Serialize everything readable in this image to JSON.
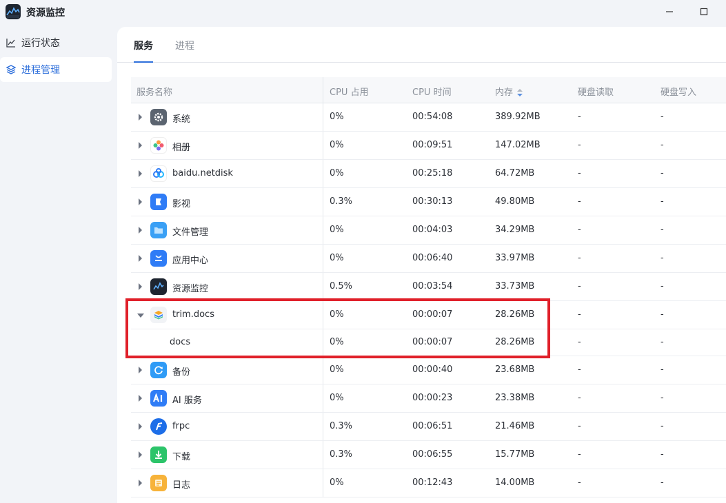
{
  "app": {
    "title": "资源监控",
    "icon": "resource-monitor-icon"
  },
  "window_controls": {
    "minimize": "minimize-icon",
    "maximize": "maximize-icon"
  },
  "sidebar": {
    "items": [
      {
        "label": "运行状态",
        "icon": "line-chart-icon",
        "active": false
      },
      {
        "label": "进程管理",
        "icon": "layers-icon",
        "active": true
      }
    ]
  },
  "tabs": [
    {
      "label": "服务",
      "active": true
    },
    {
      "label": "进程",
      "active": false
    }
  ],
  "table": {
    "headers": {
      "name": "服务名称",
      "cpu": "CPU 占用",
      "time": "CPU 时间",
      "mem": "内存",
      "read": "硬盘读取",
      "write": "硬盘写入"
    },
    "sort_icon": "sort-icon",
    "rows": [
      {
        "name": "系统",
        "cpu": "0%",
        "time": "00:54:08",
        "mem": "389.92MB",
        "read": "-",
        "write": "-",
        "icon": "gear-icon"
      },
      {
        "name": "相册",
        "cpu": "0%",
        "time": "00:09:51",
        "mem": "147.02MB",
        "read": "-",
        "write": "-",
        "icon": "photos-icon"
      },
      {
        "name": "baidu.netdisk",
        "cpu": "0%",
        "time": "00:25:18",
        "mem": "64.72MB",
        "read": "-",
        "write": "-",
        "icon": "baidu-netdisk-icon"
      },
      {
        "name": "影视",
        "cpu": "0.3%",
        "time": "00:30:13",
        "mem": "49.80MB",
        "read": "-",
        "write": "-",
        "icon": "video-icon"
      },
      {
        "name": "文件管理",
        "cpu": "0%",
        "time": "00:04:03",
        "mem": "34.29MB",
        "read": "-",
        "write": "-",
        "icon": "folder-icon"
      },
      {
        "name": "应用中心",
        "cpu": "0%",
        "time": "00:06:40",
        "mem": "33.97MB",
        "read": "-",
        "write": "-",
        "icon": "app-store-icon"
      },
      {
        "name": "资源监控",
        "cpu": "0.5%",
        "time": "00:03:54",
        "mem": "33.73MB",
        "read": "-",
        "write": "-",
        "icon": "resource-monitor-icon"
      },
      {
        "name": "trim.docs",
        "cpu": "0%",
        "time": "00:00:07",
        "mem": "28.26MB",
        "read": "-",
        "write": "-",
        "icon": "docs-icon",
        "expanded": true
      },
      {
        "name": "docs",
        "cpu": "0%",
        "time": "00:00:07",
        "mem": "28.26MB",
        "read": "-",
        "write": "-",
        "child": true
      },
      {
        "name": "备份",
        "cpu": "0%",
        "time": "00:00:40",
        "mem": "23.68MB",
        "read": "-",
        "write": "-",
        "icon": "backup-icon"
      },
      {
        "name": "AI 服务",
        "cpu": "0%",
        "time": "00:00:23",
        "mem": "23.38MB",
        "read": "-",
        "write": "-",
        "icon": "ai-icon"
      },
      {
        "name": "frpc",
        "cpu": "0.3%",
        "time": "00:06:51",
        "mem": "21.46MB",
        "read": "-",
        "write": "-",
        "icon": "frpc-icon"
      },
      {
        "name": "下载",
        "cpu": "0.3%",
        "time": "00:06:55",
        "mem": "15.77MB",
        "read": "-",
        "write": "-",
        "icon": "download-icon"
      },
      {
        "name": "日志",
        "cpu": "0%",
        "time": "00:12:43",
        "mem": "14.00MB",
        "read": "-",
        "write": "-",
        "icon": "log-icon"
      }
    ]
  },
  "colors": {
    "accent": "#2e6fdb",
    "highlight": "#e0202a"
  }
}
